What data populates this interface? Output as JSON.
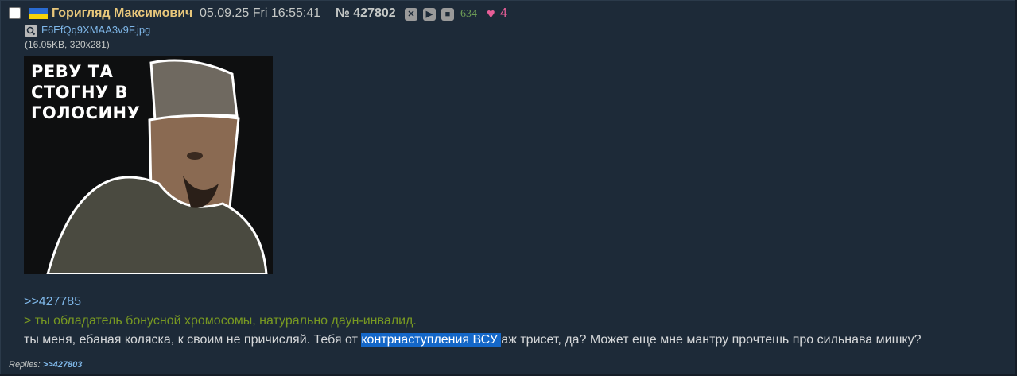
{
  "post": {
    "author": "Горигляд Максимович",
    "datetime": "05.09.25 Fri 16:55:41",
    "number": "№ 427802",
    "view_count": "634",
    "likes": "4",
    "colors": {
      "name": "#e8c77b",
      "link": "#7fb7e8",
      "greentext": "#789922",
      "likes": "#e75e97",
      "highlight": "#1467c8"
    }
  },
  "file": {
    "name": "F6EfQq9XMAA3v9F.jpg",
    "info": "(16.05KB, 320x281)",
    "caption": "РЕВУ ТА\nСТОГНУ В\nГОЛОСИНУ"
  },
  "body": {
    "reply_link": ">>427785",
    "quote": "> ты обладатель бонусной хромосомы, натурально даун-инвалид.",
    "text_before": "ты меня, ебаная коляска, к своим не причисляй. Тебя от ",
    "text_highlighted": "контрнаступления ВСУ ",
    "text_after": "аж трисет, да? Может еще мне мантру прочтешь про сильнава мишку?"
  },
  "replies": {
    "label": "Replies:",
    "link": ">>427803"
  }
}
